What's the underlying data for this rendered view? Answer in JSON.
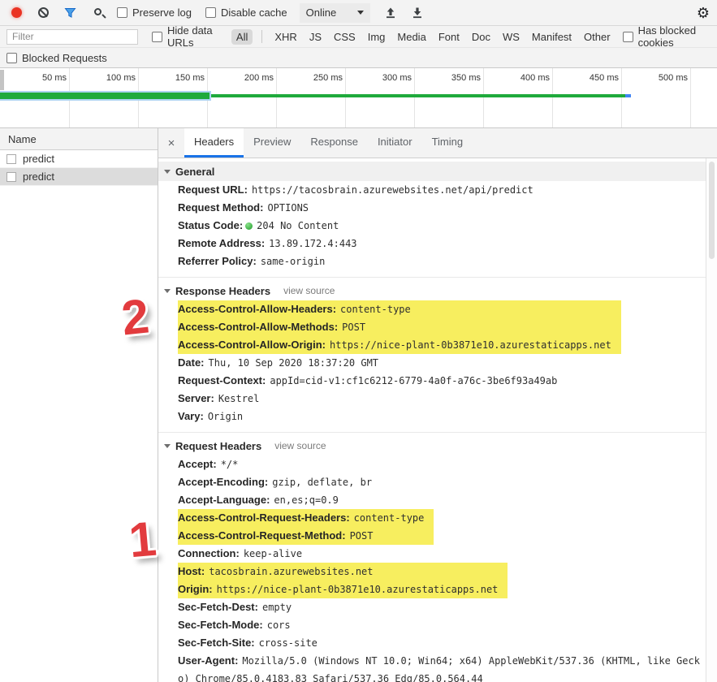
{
  "toolbar": {
    "preserve_log": "Preserve log",
    "disable_cache": "Disable cache",
    "throttling_value": "Online",
    "settings_glyph": "⚙"
  },
  "filter_bar": {
    "filter_placeholder": "Filter",
    "hide_data_urls": "Hide data URLs",
    "types": {
      "all": "All",
      "xhr": "XHR",
      "js": "JS",
      "css": "CSS",
      "img": "Img",
      "media": "Media",
      "font": "Font",
      "doc": "Doc",
      "ws": "WS",
      "manifest": "Manifest",
      "other": "Other"
    },
    "active_type": "All",
    "has_blocked_cookies": "Has blocked cookies",
    "blocked_requests": "Blocked Requests"
  },
  "overview": {
    "ticks": [
      "50 ms",
      "100 ms",
      "150 ms",
      "200 ms",
      "250 ms",
      "300 ms",
      "350 ms",
      "400 ms",
      "450 ms",
      "500 ms"
    ]
  },
  "requests": {
    "column_header": "Name",
    "rows": [
      {
        "name": "predict"
      },
      {
        "name": "predict"
      }
    ]
  },
  "details": {
    "close": "×",
    "tabs": {
      "headers": "Headers",
      "preview": "Preview",
      "response": "Response",
      "initiator": "Initiator",
      "timing": "Timing"
    },
    "active_tab": "Headers",
    "view_source": "view source",
    "general": {
      "title": "General",
      "rows": [
        {
          "name": "Request URL:",
          "value": "https://tacosbrain.azurewebsites.net/api/predict"
        },
        {
          "name": "Request Method:",
          "value": "OPTIONS"
        },
        {
          "name": "Status Code:",
          "value": "204 No Content"
        },
        {
          "name": "Remote Address:",
          "value": "13.89.172.4:443"
        },
        {
          "name": "Referrer Policy:",
          "value": "same-origin"
        }
      ]
    },
    "response_headers": {
      "title": "Response Headers",
      "highlighted": [
        {
          "name": "Access-Control-Allow-Headers:",
          "value": "content-type"
        },
        {
          "name": "Access-Control-Allow-Methods:",
          "value": "POST"
        },
        {
          "name": "Access-Control-Allow-Origin:",
          "value": "https://nice-plant-0b3871e10.azurestaticapps.net"
        }
      ],
      "rows": [
        {
          "name": "Date:",
          "value": "Thu, 10 Sep 2020 18:37:20 GMT"
        },
        {
          "name": "Request-Context:",
          "value": "appId=cid-v1:cf1c6212-6779-4a0f-a76c-3be6f93a49ab"
        },
        {
          "name": "Server:",
          "value": "Kestrel"
        },
        {
          "name": "Vary:",
          "value": "Origin"
        }
      ]
    },
    "request_headers": {
      "title": "Request Headers",
      "rows_a": [
        {
          "name": "Accept:",
          "value": "*/*"
        },
        {
          "name": "Accept-Encoding:",
          "value": "gzip, deflate, br"
        },
        {
          "name": "Accept-Language:",
          "value": "en,es;q=0.9"
        }
      ],
      "highlighted_a": [
        {
          "name": "Access-Control-Request-Headers:",
          "value": "content-type"
        },
        {
          "name": "Access-Control-Request-Method:",
          "value": "POST"
        }
      ],
      "rows_b": [
        {
          "name": "Connection:",
          "value": "keep-alive"
        }
      ],
      "highlighted_b": [
        {
          "name": "Host:",
          "value": "tacosbrain.azurewebsites.net"
        },
        {
          "name": "Origin:",
          "value": "https://nice-plant-0b3871e10.azurestaticapps.net"
        }
      ],
      "rows_c": [
        {
          "name": "Sec-Fetch-Dest:",
          "value": "empty"
        },
        {
          "name": "Sec-Fetch-Mode:",
          "value": "cors"
        },
        {
          "name": "Sec-Fetch-Site:",
          "value": "cross-site"
        },
        {
          "name": "User-Agent:",
          "value": "Mozilla/5.0 (Windows NT 10.0; Win64; x64) AppleWebKit/537.36 (KHTML, like Gecko) Chrome/85.0.4183.83 Safari/537.36 Edg/85.0.564.44"
        }
      ]
    }
  },
  "annotations": {
    "step1": "1",
    "step2": "2"
  },
  "colors": {
    "accent_blue": "#1a73e8",
    "highlight_yellow": "#f7ee5f",
    "annotation_red": "#e23b3e",
    "timeline_green": "#1faa3c",
    "status_green": "#1d9a28"
  }
}
